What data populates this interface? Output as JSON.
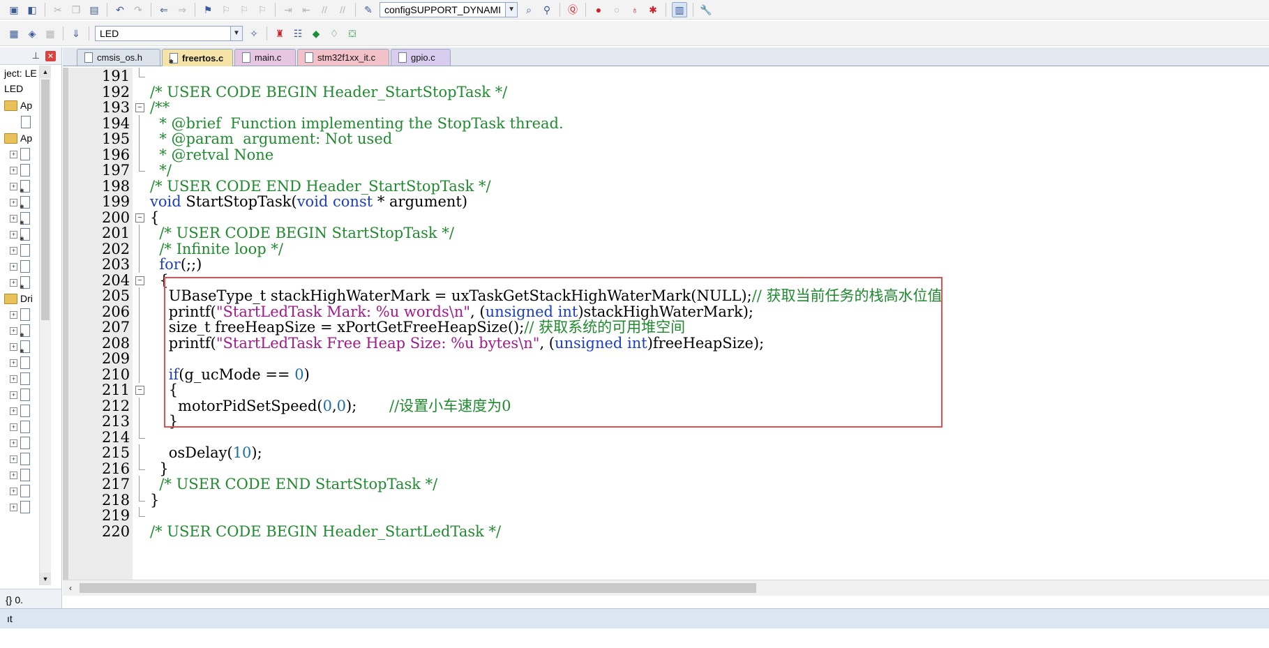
{
  "toolbar1": {
    "symbol_combo": "configSUPPORT_DYNAMI"
  },
  "toolbar2": {
    "target_combo": "LED"
  },
  "project_panel": {
    "title": "ject: LE",
    "root": "LED",
    "folders": [
      "Ap",
      "Ap",
      "Dri"
    ]
  },
  "tabs": [
    {
      "label": "cmsis_os.h",
      "active": false,
      "color": "#dde3ea"
    },
    {
      "label": "freertos.c",
      "active": true,
      "color": "#f6e3a6"
    },
    {
      "label": "main.c",
      "active": false,
      "color": "#e7c6e2"
    },
    {
      "label": "stm32f1xx_it.c",
      "active": false,
      "color": "#f3c2c9"
    },
    {
      "label": "gpio.c",
      "active": false,
      "color": "#d9cdef"
    }
  ],
  "code": [
    {
      "n": "191",
      "fold": "end",
      "t": []
    },
    {
      "n": "192",
      "fold": "",
      "t": [
        [
          "cm",
          "/* USER CODE BEGIN Header_StartStopTask */"
        ]
      ]
    },
    {
      "n": "193",
      "fold": "box",
      "t": [
        [
          "cm",
          "/**"
        ]
      ]
    },
    {
      "n": "194",
      "fold": "line",
      "t": [
        [
          "cm",
          "  * @brief  Function implementing the StopTask thread."
        ]
      ]
    },
    {
      "n": "195",
      "fold": "line",
      "t": [
        [
          "cm",
          "  * @param  argument: Not used"
        ]
      ]
    },
    {
      "n": "196",
      "fold": "line",
      "t": [
        [
          "cm",
          "  * @retval None"
        ]
      ]
    },
    {
      "n": "197",
      "fold": "end",
      "t": [
        [
          "cm",
          "  */"
        ]
      ]
    },
    {
      "n": "198",
      "fold": "",
      "t": [
        [
          "cm",
          "/* USER CODE END Header_StartStopTask */"
        ]
      ]
    },
    {
      "n": "199",
      "fold": "",
      "t": [
        [
          "kw",
          "void"
        ],
        [
          "pl",
          " StartStopTask("
        ],
        [
          "kw",
          "void const"
        ],
        [
          "pl",
          " * argument)"
        ]
      ]
    },
    {
      "n": "200",
      "fold": "box",
      "t": [
        [
          "pl",
          "{"
        ]
      ]
    },
    {
      "n": "201",
      "fold": "line",
      "t": [
        [
          "cm",
          "  /* USER CODE BEGIN StartStopTask */"
        ]
      ]
    },
    {
      "n": "202",
      "fold": "line",
      "t": [
        [
          "cm",
          "  /* Infinite loop */"
        ]
      ]
    },
    {
      "n": "203",
      "fold": "line",
      "t": [
        [
          "kw",
          "  for"
        ],
        [
          "pl",
          "(;;)"
        ]
      ]
    },
    {
      "n": "204",
      "fold": "box",
      "t": [
        [
          "pl",
          "  {"
        ]
      ]
    },
    {
      "n": "205",
      "fold": "line",
      "t": [
        [
          "pl",
          "    UBaseType_t stackHighWaterMark = uxTaskGetStackHighWaterMark(NULL);"
        ],
        [
          "cm",
          "// 获取当前任务的栈高水位值"
        ]
      ]
    },
    {
      "n": "206",
      "fold": "line",
      "t": [
        [
          "pl",
          "    printf("
        ],
        [
          "str",
          "\"StartLedTask Mark: %u words\\n\""
        ],
        [
          "pl",
          ", ("
        ],
        [
          "kw",
          "unsigned int"
        ],
        [
          "pl",
          ")stackHighWaterMark);"
        ]
      ]
    },
    {
      "n": "207",
      "fold": "line",
      "t": [
        [
          "pl",
          "    size_t freeHeapSize = xPortGetFreeHeapSize();"
        ],
        [
          "cm",
          "// 获取系统的可用堆空间"
        ]
      ]
    },
    {
      "n": "208",
      "fold": "line",
      "t": [
        [
          "pl",
          "    printf("
        ],
        [
          "str",
          "\"StartLedTask Free Heap Size: %u bytes\\n\""
        ],
        [
          "pl",
          ", ("
        ],
        [
          "kw",
          "unsigned int"
        ],
        [
          "pl",
          ")freeHeapSize);"
        ]
      ]
    },
    {
      "n": "209",
      "fold": "line",
      "t": []
    },
    {
      "n": "210",
      "fold": "line",
      "t": [
        [
          "kw",
          "    if"
        ],
        [
          "pl",
          "(g_ucMode == "
        ],
        [
          "num",
          "0"
        ],
        [
          "pl",
          ")"
        ]
      ]
    },
    {
      "n": "211",
      "fold": "box",
      "t": [
        [
          "pl",
          "    {"
        ]
      ]
    },
    {
      "n": "212",
      "fold": "line",
      "t": [
        [
          "pl",
          "      motorPidSetSpeed("
        ],
        [
          "num",
          "0"
        ],
        [
          "pl",
          ","
        ],
        [
          "num",
          "0"
        ],
        [
          "pl",
          ");       "
        ],
        [
          "cm",
          "//设置小车速度为0"
        ]
      ]
    },
    {
      "n": "213",
      "fold": "line",
      "t": [
        [
          "pl",
          "    }"
        ]
      ]
    },
    {
      "n": "214",
      "fold": "tick",
      "t": []
    },
    {
      "n": "215",
      "fold": "line",
      "t": [
        [
          "pl",
          "    osDelay("
        ],
        [
          "num",
          "10"
        ],
        [
          "pl",
          ");"
        ]
      ]
    },
    {
      "n": "216",
      "fold": "tick",
      "t": [
        [
          "pl",
          "  }"
        ]
      ]
    },
    {
      "n": "217",
      "fold": "line",
      "t": [
        [
          "cm",
          "  /* USER CODE END StartStopTask */"
        ]
      ]
    },
    {
      "n": "218",
      "fold": "tick",
      "t": [
        [
          "pl",
          "}"
        ]
      ]
    },
    {
      "n": "219",
      "fold": "end",
      "t": []
    },
    {
      "n": "220",
      "fold": "",
      "t": [
        [
          "cm",
          "/* USER CODE BEGIN Header_StartLedTask */"
        ]
      ]
    }
  ],
  "status_bar": {
    "text": "ıt"
  }
}
